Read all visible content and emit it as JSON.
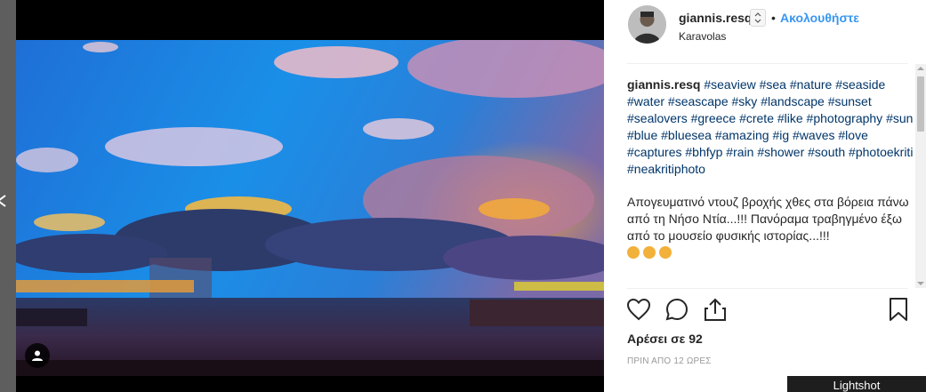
{
  "post": {
    "username": "giannis.resq",
    "separator": "•",
    "follow_label": "Ακολουθήστε",
    "location": "Karavolas",
    "verified_select_glyph": "⌃⌄"
  },
  "caption": {
    "username": "giannis.resq",
    "hashtags": "#seaview #sea #nature #seaside #water #seascape #sky #landscape #sunset #sealovers #greece #crete #like #photography #sun #blue #bluesea #amazing #ig #waves #love #captures #bhfyp #rain #shower #south #photoekriti #neakritiphoto",
    "text": "Απογευματινό ντουζ βροχής χθες στα βόρεια πάνω από τη Νήσο Ντία...!!! Πανόραμα τραβηγμένο έξω από το μουσείο φυσικής ιστορίας...!!!"
  },
  "stats": {
    "likes_label": "Αρέσει σε 92",
    "time_label": "ΠΡΙΝ ΑΠΟ 12 ΩΡΕΣ"
  },
  "icons": {
    "like": "heart-icon",
    "comment": "comment-bubble-icon",
    "share": "share-icon",
    "save": "bookmark-icon",
    "tag": "user-tag-icon",
    "prev": "chevron-left-icon"
  },
  "overlay": {
    "lightshot_label": "Lightshot"
  },
  "colors": {
    "link_blue": "#3897f0",
    "hashtag_blue": "#003569",
    "text": "#262626",
    "muted": "#999999"
  }
}
